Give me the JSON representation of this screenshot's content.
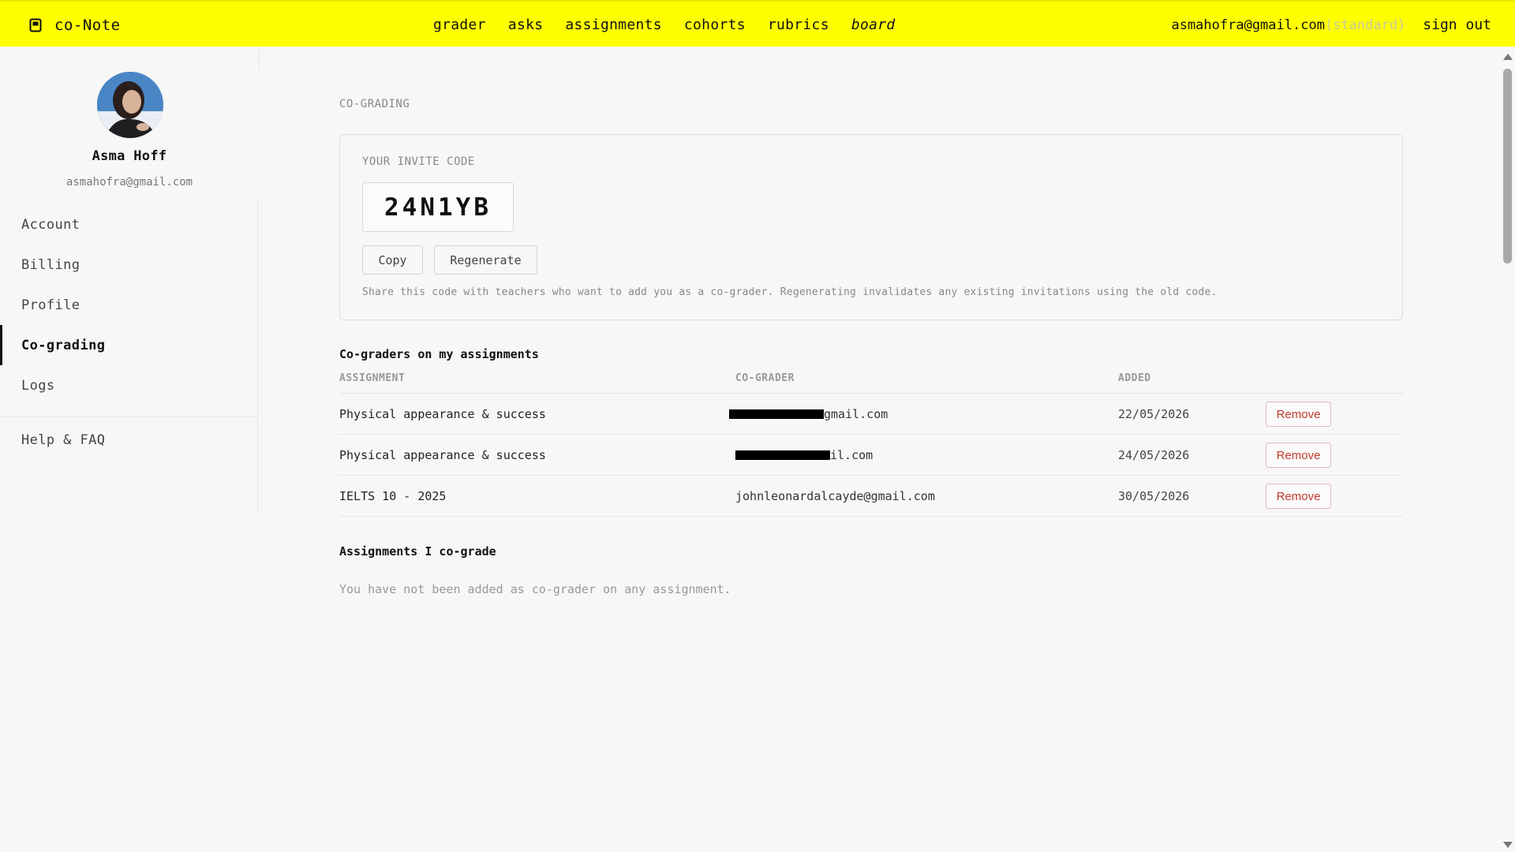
{
  "app": {
    "name": "co-Note",
    "logo_icon": "notebook-icon"
  },
  "nav": {
    "items": [
      "grader",
      "asks",
      "assignments",
      "cohorts",
      "rubrics",
      "board"
    ]
  },
  "user": {
    "email": "asmahofra@gmail.com",
    "plan": "(standard)",
    "sign_out": "sign out"
  },
  "profile": {
    "name": "Asma Hoff",
    "email": "asmahofra@gmail.com"
  },
  "sidebar": {
    "items": [
      {
        "label": "Account"
      },
      {
        "label": "Billing"
      },
      {
        "label": "Profile"
      },
      {
        "label": "Co-grading",
        "active": true
      },
      {
        "label": "Logs"
      }
    ],
    "help": "Help & FAQ"
  },
  "main": {
    "section_label": "CO-GRADING",
    "invite": {
      "label": "YOUR INVITE CODE",
      "code": "24N1YB",
      "copy_label": "Copy",
      "regenerate_label": "Regenerate",
      "help": "Share this code with teachers who want to add you as a co-grader. Regenerating invalidates any existing invitations using the old code."
    },
    "cograders": {
      "heading": "Co-graders on my assignments",
      "columns": [
        "ASSIGNMENT",
        "CO-GRADER",
        "ADDED"
      ],
      "rows": [
        {
          "assignment": "Physical appearance & success",
          "grader_visible": "gmail.com",
          "redacted": true,
          "added": "22/05/2026",
          "action": "Remove"
        },
        {
          "assignment": "Physical appearance & success",
          "grader_visible": "il.com",
          "redacted": true,
          "added": "24/05/2026",
          "action": "Remove"
        },
        {
          "assignment": "IELTS 10 - 2025",
          "grader_visible": "johnleonardalcayde@gmail.com",
          "redacted": false,
          "added": "30/05/2026",
          "action": "Remove"
        }
      ]
    },
    "cograde": {
      "heading": "Assignments I co-grade",
      "empty": "You have not been added as co-grader on any assignment."
    }
  },
  "colors": {
    "topbar": "#ffff00",
    "remove_text": "#c0392b",
    "remove_border": "#e2b9b9"
  }
}
